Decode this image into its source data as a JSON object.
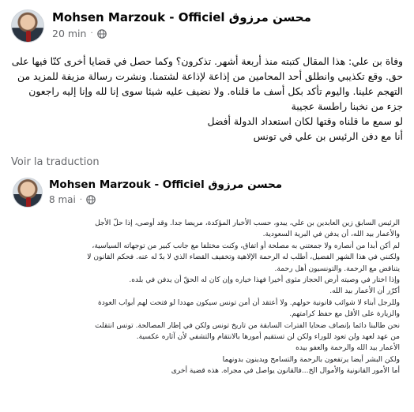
{
  "post": {
    "author": "Mohsen Marzouk - Officiel محسن مرزوق",
    "time": "20 min",
    "separator": "·",
    "privacy_icon": "globe-icon",
    "paragraphs": [
      "وفاة بن علي: هذا المقال كتبته منذ أربعة أشهر. تذكرون؟ وكما حصل في قضايا أخرى كنّا فيها على",
      "حق. وقع تكذيبي وانطلق أحد المحامين من إذاعة لإذاعة لشتمنا. ونشرت رسالة مزيفة للمزيد من",
      "التهجم علينا. واليوم تأكد بكل أسف ما قلناه. ولا نضيف عليه شيئا سوى إنا لله وإنا إليه راجعون",
      "جزء من نخبنا راطسة عجيبة",
      "لو سمع ما قلناه وقتها لكان استعداد الدولة أفضل",
      "أنا مع دفن الرئيس بن علي في تونس"
    ]
  },
  "see_translation": "Voir la traduction",
  "shared_post": {
    "author": "Mohsen Marzouk - Officiel محسن مرزوق",
    "time": "8 mai",
    "separator": "·",
    "privacy_icon": "globe-icon",
    "paragraphs": [
      "الرئيس السابق زين العابدين بن علي، يبدو، حسب الأخبار المؤكدة، مريضا جدا. وقد أوصى، إذا حلّ الأجل",
      "والأعمار بيد الله، أن يدفن في البرية السعودية.",
      "لم أكن أبدا من أنصاره ولا جمعتني به مصلحة أو اتفاق، وكنت مختلفا مع جانب كبير من توجهاته السياسية،",
      "ولكنني في هذا الشهر الفضيل، أطلب له الرحمة الإلاهية وتخفيف القضاء الذي لا بدّ له عنه. فحكم القانون لا",
      "يتناقض مع الرحمة. والتونسيون أهل رحمة.",
      "وإذا اختار في وصيته أرض الحجاز مثوى أخيرا فهذا خياره وإن كان له الحقّ أن يدفن في بلده.",
      "أكرّر أن الأعمار بيد الله.",
      "وللرجل أبناء لا شوائب قانونية حولهم. ولا أعتقد أن أمن تونس سيكون مهددا لو فتحت لهم أبواب العودة",
      "والزيارة على الأقل مع حفظ كرامتهم.",
      "نحن طالبنا دائما بإنصاف ضحايا الفترات السابقة من تاريخ تونس ولكن في إطار المصالحة. تونس انتقلت",
      "من عهد لعهد ولن تعود للوراء ولكن لن تستقيم أمورها بالانتقام والتشفي لأن آثاره عكسية.",
      "الأعمار بيد الله والرحمة والعفو بيده",
      "ولكن البشر أيضا يرتفعون بالرحمة والتسامح ويدينون بدونهما",
      "أما الأمور القانونية والأموال الخ...فالقانون يواصل في مجراه. هذه قضية أخرى"
    ]
  }
}
